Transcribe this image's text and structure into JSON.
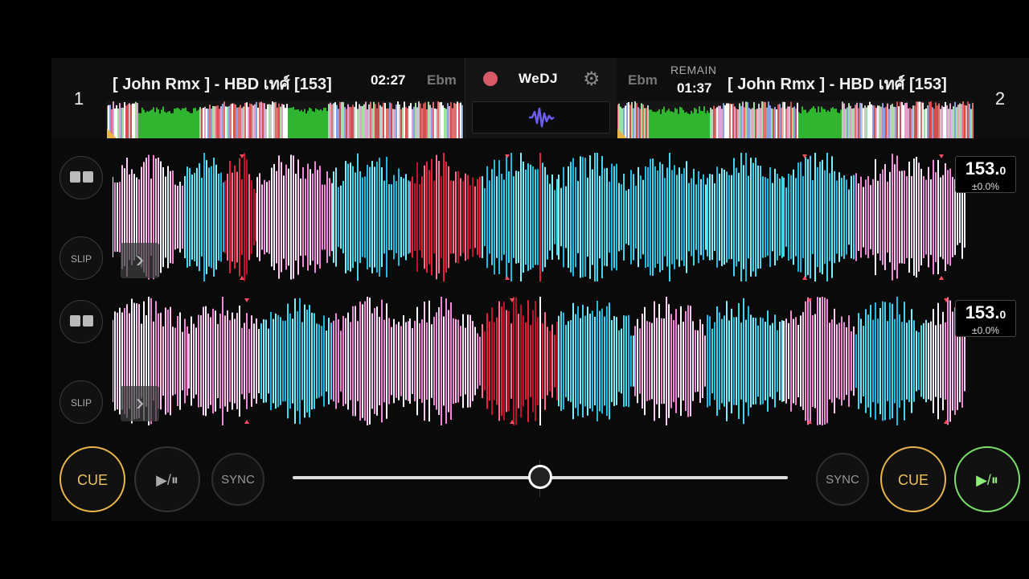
{
  "deck1": {
    "number": "1",
    "title": "[ John Rmx ] - HBD เทศ์ [153]",
    "time": "02:27",
    "key": "Ebm",
    "bpm_main": "153.",
    "bpm_dec": "0",
    "pitch": "±0.0%",
    "slip_label": "SLIP",
    "cue_label": "CUE",
    "play_label": "▶/⏸",
    "sync_label": "SYNC"
  },
  "deck2": {
    "number": "2",
    "title": "[ John Rmx ] - HBD เทศ์ [153]",
    "remain_label": "REMAIN",
    "time": "01:37",
    "key": "Ebm",
    "bpm_main": "153.",
    "bpm_dec": "0",
    "pitch": "±0.0%",
    "slip_label": "SLIP",
    "cue_label": "CUE",
    "play_label": "▶/⏸",
    "sync_label": "SYNC"
  },
  "center": {
    "brand": "WeDJ",
    "record_icon": "record-icon",
    "settings_icon": "gear-icon",
    "waveform_icon": "waveform-icon"
  },
  "crossfader": {
    "position": 0.5
  },
  "colors": {
    "cue": "#e8b54a",
    "play_active": "#7be06a",
    "record": "#d75a68",
    "wave_cyan": "#3fd7f0",
    "wave_pink": "#f08ad8",
    "wave_red": "#e0243c",
    "overview_green": "#2fb52f"
  }
}
